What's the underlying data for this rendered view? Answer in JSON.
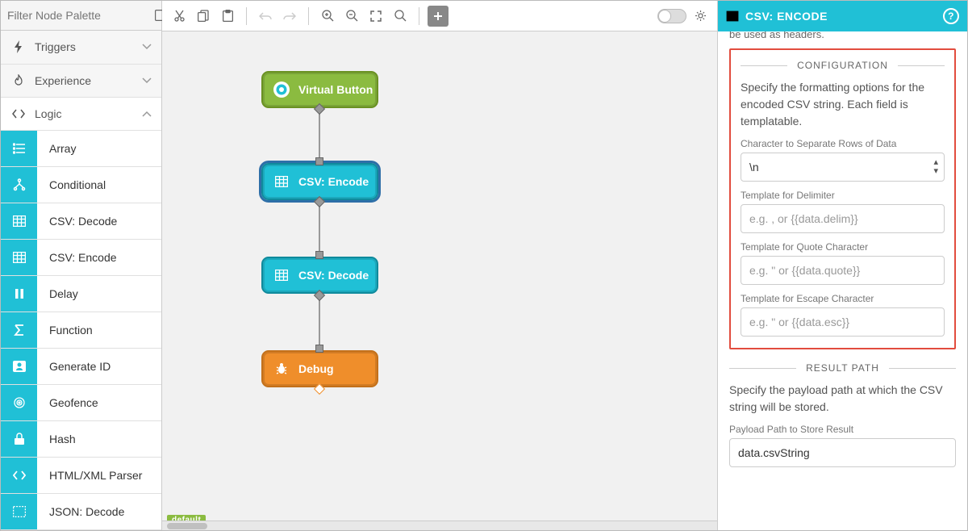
{
  "sidebar": {
    "filter_placeholder": "Filter Node Palette",
    "categories": [
      {
        "id": "triggers",
        "label": "Triggers",
        "expanded": false,
        "icon": "bolt"
      },
      {
        "id": "experience",
        "label": "Experience",
        "expanded": false,
        "icon": "flame"
      },
      {
        "id": "logic",
        "label": "Logic",
        "expanded": true,
        "icon": "code"
      }
    ],
    "logic_items": [
      {
        "label": "Array",
        "icon": "list"
      },
      {
        "label": "Conditional",
        "icon": "branch"
      },
      {
        "label": "CSV: Decode",
        "icon": "table"
      },
      {
        "label": "CSV: Encode",
        "icon": "table"
      },
      {
        "label": "Delay",
        "icon": "pause"
      },
      {
        "label": "Function",
        "icon": "sigma"
      },
      {
        "label": "Generate ID",
        "icon": "idcard"
      },
      {
        "label": "Geofence",
        "icon": "target"
      },
      {
        "label": "Hash",
        "icon": "lock"
      },
      {
        "label": "HTML/XML Parser",
        "icon": "angle"
      },
      {
        "label": "JSON: Decode",
        "icon": "json"
      }
    ]
  },
  "canvas": {
    "default_tag": "default",
    "nodes": [
      {
        "id": "virtual-button",
        "label": "Virtual Button",
        "type": "green",
        "icon": "circle-dot",
        "selected": false
      },
      {
        "id": "csv-encode",
        "label": "CSV: Encode",
        "type": "teal",
        "icon": "table",
        "selected": true
      },
      {
        "id": "csv-decode",
        "label": "CSV: Decode",
        "type": "teal",
        "icon": "table",
        "selected": false
      },
      {
        "id": "debug",
        "label": "Debug",
        "type": "orange",
        "icon": "bug",
        "selected": false
      }
    ]
  },
  "inspector": {
    "title": "CSV: ENCODE",
    "truncated_partial": "be used as headers.",
    "config_heading": "CONFIGURATION",
    "config_desc": "Specify the formatting options for the encoded CSV string. Each field is templatable.",
    "row_sep_label": "Character to Separate Rows of Data",
    "row_sep_value": "\\n",
    "delim_label": "Template for Delimiter",
    "delim_placeholder": "e.g. , or {{data.delim}}",
    "quote_label": "Template for Quote Character",
    "quote_placeholder": "e.g. \" or {{data.quote}}",
    "escape_label": "Template for Escape Character",
    "escape_placeholder": "e.g. \" or {{data.esc}}",
    "result_heading": "RESULT PATH",
    "result_desc": "Specify the payload path at which the CSV string will be stored.",
    "result_label": "Payload Path to Store Result",
    "result_value": "data.csvString"
  }
}
